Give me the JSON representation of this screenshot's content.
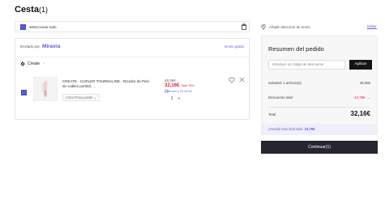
{
  "page": {
    "title": "Cesta",
    "count": "(1)"
  },
  "cart": {
    "select_all_label": "Seleccionar todo",
    "sold_by_label": "Enviado por",
    "seller_brand": "Miravia",
    "shipping_free": "Envío gratis",
    "store_name": "Create",
    "item": {
      "name": "CREATE - CURLER TOURMALINE - Rizador de Pelo sin cables portátil, ...",
      "variant": "Color:Rosa pastel",
      "original_price": "45,95€",
      "price": "32,16€",
      "savings": "Save 30%",
      "delivery": "Envío ≥ 23.10.00",
      "quantity": "1",
      "minus": "-",
      "plus": "+"
    }
  },
  "address": {
    "label": "Añadir dirección de envío",
    "edit": "Editar"
  },
  "summary": {
    "title": "Resumen del pedido",
    "coupon_placeholder": "Introduce un código de descuento",
    "apply_label": "Aplicar",
    "subtotal_label": "Subtotal: 1 artículo(s)",
    "subtotal_value": "45,95€",
    "discount_label": "Descuento total",
    "discount_value": "-13,79€",
    "total_label": "Total",
    "total_value": "32,16€",
    "saved_text": "¡Genial! Has ahorrado:",
    "saved_value": "13,79€"
  },
  "checkout": {
    "continue_label": "Continuar(1)"
  },
  "colors": {
    "accent": "#5b5bd6",
    "price_red": "#e21a3c",
    "dark_button": "#26262f"
  }
}
